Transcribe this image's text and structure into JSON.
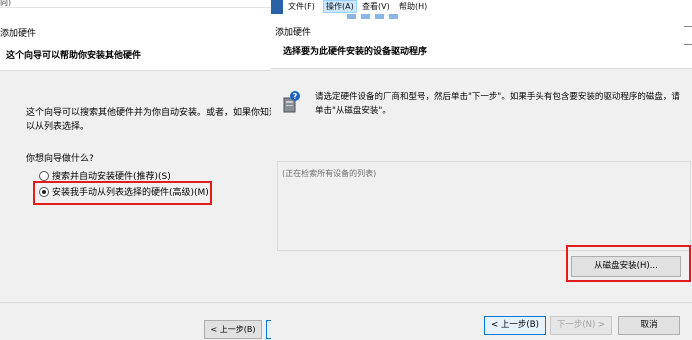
{
  "left_wizard": {
    "top_fragment": "向)",
    "title": "添加硬件",
    "subtitle": "这个向导可以帮助你安装其他硬件",
    "description_line1": "这个向导可以搜索其他硬件并为你自动安装。或者，如果你知道要",
    "description_line2": "以从列表选择。",
    "question": "你想向导做什么?",
    "option_auto": "搜索并自动安装硬件(推荐)(S)",
    "option_manual": "安装我手动从列表选择的硬件(高级)(M)",
    "back_button": "< 上一步(B)"
  },
  "right_window": {
    "menu": {
      "file": "文件(F)",
      "action": "操作(A)",
      "view": "查看(V)",
      "help": "帮助(H)"
    },
    "title": "添加硬件",
    "subtitle": "选择要为此硬件安装的设备驱动程序",
    "description": "请选定硬件设备的厂商和型号，然后单击\"下一步\"。如果手头有包含要安装的驱动程序的磁盘，请单击\"从磁盘安装\"。",
    "list_placeholder": "(正在检索所有设备的列表)",
    "have_disk_button": "从磁盘安装(H)...",
    "back_button": "< 上一步(B)",
    "next_button": "下一步(N) >",
    "cancel_button": "取消"
  },
  "colors": {
    "highlight_red": "#e21c1c",
    "accent_blue": "#0078d7"
  }
}
